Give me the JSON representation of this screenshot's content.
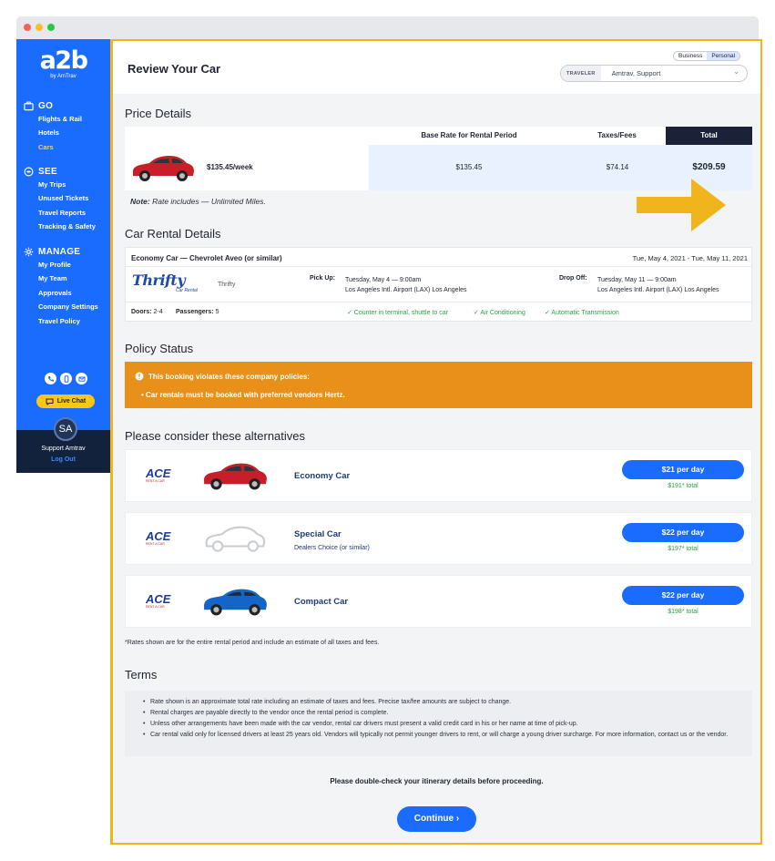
{
  "sidebar": {
    "logo": "a2b",
    "logo_sub": "by AmTrav",
    "go": {
      "title": "GO",
      "items": [
        {
          "label": "Flights & Rail"
        },
        {
          "label": "Hotels"
        },
        {
          "label": "Cars"
        }
      ]
    },
    "see": {
      "title": "SEE",
      "items": [
        {
          "label": "My Trips"
        },
        {
          "label": "Unused Tickets"
        },
        {
          "label": "Travel Reports"
        },
        {
          "label": "Tracking & Safety"
        }
      ]
    },
    "manage": {
      "title": "MANAGE",
      "items": [
        {
          "label": "My Profile"
        },
        {
          "label": "My Team"
        },
        {
          "label": "Approvals"
        },
        {
          "label": "Company Settings"
        },
        {
          "label": "Travel Policy"
        }
      ]
    },
    "live_chat": "Live Chat",
    "user_initials": "SA",
    "user_name": "Support Amtrav",
    "logout": "Log Out"
  },
  "header": {
    "title": "Review Your Car",
    "toggle": {
      "business": "Business",
      "personal": "Personal"
    },
    "traveler_label": "TRAVELER",
    "traveler_value": "Amtrav, Support"
  },
  "price_details": {
    "title": "Price Details",
    "headers": {
      "base": "Base Rate for Rental Period",
      "taxes": "Taxes/Fees",
      "total": "Total"
    },
    "weekly": "$135.45/week",
    "base": "$135.45",
    "taxes": "$74.14",
    "total": "$209.59",
    "note_label": "Note:",
    "note_text": " Rate includes — Unlimited Miles."
  },
  "rental_details": {
    "title": "Car Rental Details",
    "car": "Economy Car — Chevrolet Aveo (or similar)",
    "dates": "Tue, May 4, 2021 - Tue, May 11, 2021",
    "vendor_logo": "Thrifty",
    "vendor_logo_sub": "Car Rental",
    "vendor": "Thrifty",
    "pickup_label": "Pick Up:",
    "pickup_time": "Tuesday, May 4 — 9:00am",
    "pickup_loc": "Los Angeles Intl. Airport (LAX) Los Angeles",
    "dropoff_label": "Drop Off:",
    "dropoff_time": "Tuesday, May 11 — 9:00am",
    "dropoff_loc": "Los Angeles Intl. Airport (LAX) Los Angeles",
    "doors_label": "Doors:",
    "doors": "2-4",
    "passengers_label": "Passengers:",
    "passengers": "5",
    "features": [
      "✓ Counter in terminal, shuttle to car",
      "✓ Air Conditioning",
      "✓ Automatic Transmission"
    ]
  },
  "policy": {
    "title": "Policy Status",
    "warning": "This booking violates these company policies:",
    "item": "Car rentals must be booked with preferred vendors Hertz."
  },
  "alternatives": {
    "title": "Please consider these alternatives",
    "vendor_logo": "ACE",
    "vendor_logo_sub": "RENT A CAR",
    "items": [
      {
        "name": "Economy Car",
        "sub": "",
        "price": "$21 per day",
        "total": "$191* total",
        "color": "#c81e2a"
      },
      {
        "name": "Special Car",
        "sub": "Dealers Choice (or similar)",
        "price": "$22 per day",
        "total": "$197* total",
        "color": "#c9ccd2"
      },
      {
        "name": "Compact Car",
        "sub": "",
        "price": "$22 per day",
        "total": "$198* total",
        "color": "#1565c8"
      }
    ],
    "rates_note": "*Rates shown are for the entire rental period and include an estimate of all taxes and fees."
  },
  "terms": {
    "title": "Terms",
    "items": [
      "Rate shown is an approximate total rate including an estimate of taxes and fees. Precise tax/fee amounts are subject to change.",
      "Rental charges are payable directly to the vendor once the rental period is complete.",
      "Unless other arrangements have been made with the car vendor, rental car drivers must present a valid credit card in his or her name at time of pick-up.",
      "Car rental valid only for licensed drivers at least 25 years old. Vendors will typically not permit younger drivers to rent, or will charge a young driver surcharge. For more information, contact us or the vendor."
    ]
  },
  "footer": {
    "double_check": "Please double-check your itinerary details before proceeding.",
    "continue": "Continue ›"
  },
  "colors": {
    "primary": "#1a6cff",
    "warning": "#e8901a",
    "accent": "#f5b21a",
    "success": "#2ea043"
  }
}
